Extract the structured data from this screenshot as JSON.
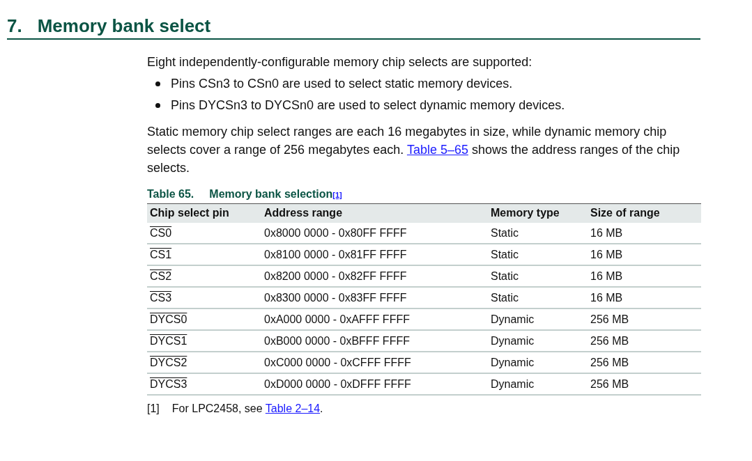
{
  "section": {
    "number": "7.",
    "title": "Memory bank select"
  },
  "intro": "Eight independently-configurable memory chip selects are supported:",
  "bullets": [
    "Pins CSn3 to CSn0 are used to select static memory devices.",
    "Pins DYCSn3 to DYCSn0 are used to select dynamic memory devices."
  ],
  "paragraph": {
    "before": "Static memory chip select ranges are each 16 megabytes in size, while dynamic memory chip selects cover a range of 256 megabytes each.",
    "link": "Table 5–65",
    "after": "shows the address ranges of the chip selects."
  },
  "table": {
    "number": "Table 65.",
    "caption": "Memory bank selection",
    "note_link": "[1]",
    "columns": [
      "Chip select pin",
      "Address range",
      "Memory type",
      "Size of range"
    ],
    "rows": [
      {
        "pin": "CS0",
        "overline": true,
        "range": "0x8000 0000 - 0x80FF FFFF",
        "type": "Static",
        "size": "16 MB"
      },
      {
        "pin": "CS1",
        "overline": true,
        "range": "0x8100 0000 - 0x81FF FFFF",
        "type": "Static",
        "size": "16 MB"
      },
      {
        "pin": "CS2",
        "overline": true,
        "range": "0x8200 0000 - 0x82FF FFFF",
        "type": "Static",
        "size": "16 MB"
      },
      {
        "pin": "CS3",
        "overline": true,
        "range": "0x8300 0000 - 0x83FF FFFF",
        "type": "Static",
        "size": "16 MB"
      },
      {
        "pin": "DYCS0",
        "overline": true,
        "range": "0xA000 0000 - 0xAFFF FFFF",
        "type": "Dynamic",
        "size": "256 MB"
      },
      {
        "pin": "DYCS1",
        "overline": true,
        "range": "0xB000 0000 - 0xBFFF FFFF",
        "type": "Dynamic",
        "size": "256 MB"
      },
      {
        "pin": "DYCS2",
        "overline": true,
        "range": "0xC000 0000 - 0xCFFF FFFF",
        "type": "Dynamic",
        "size": "256 MB"
      },
      {
        "pin": "DYCS3",
        "overline": true,
        "range": "0xD000 0000 - 0xDFFF FFFF",
        "type": "Dynamic",
        "size": "256 MB"
      }
    ]
  },
  "footnote": {
    "marker": "[1]",
    "before": "For LPC2458, see",
    "link": "Table 2–14",
    "after": "."
  }
}
